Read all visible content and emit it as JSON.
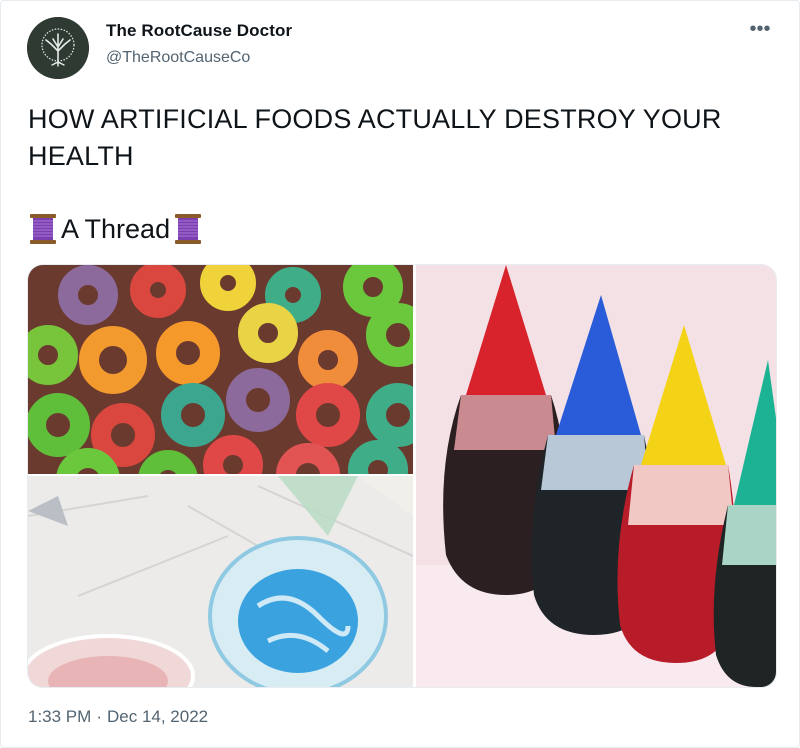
{
  "author": {
    "name": "The RootCause Doctor",
    "handle": "@TheRootCauseCo"
  },
  "menu_icon": "more-horizontal-icon",
  "tweet": {
    "text": "HOW ARTIFICIAL FOODS ACTUALLY DESTROY YOUR HEALTH",
    "thread_label": "A Thread",
    "emoji": "spool-of-thread"
  },
  "media": [
    {
      "subject": "colorful ring cereal"
    },
    {
      "subject": "blue frosting being mixed in a glass bowl"
    },
    {
      "subject": "bottles of food coloring"
    }
  ],
  "meta": {
    "time": "1:33 PM",
    "separator": "·",
    "date": "Dec 14, 2022"
  },
  "colors": {
    "text": "#0f1419",
    "secondary": "#536471",
    "thread_purple": "#7b3fb0"
  }
}
